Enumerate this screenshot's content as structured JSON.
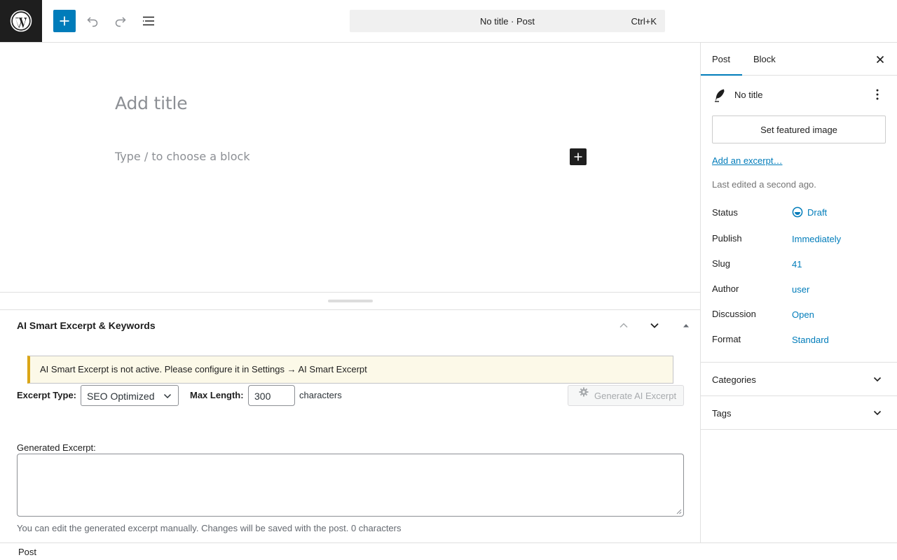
{
  "header": {
    "command_bar_title": "No title · Post",
    "command_bar_shortcut": "Ctrl+K"
  },
  "editor": {
    "title_placeholder": "Add title",
    "block_placeholder": "Type / to choose a block"
  },
  "metabox": {
    "title": "AI Smart Excerpt & Keywords",
    "notice": "AI Smart Excerpt is not active. Please configure it in Settings → AI Smart Excerpt",
    "excerpt_type_label": "Excerpt Type:",
    "excerpt_type_value": "SEO Optimized",
    "max_length_label": "Max Length:",
    "max_length_value": "300",
    "characters_label": "characters",
    "generate_button": "Generate AI Excerpt",
    "generated_label": "Generated Excerpt:",
    "help_text": "You can edit the generated excerpt manually. Changes will be saved with the post. 0 characters"
  },
  "footer": {
    "breadcrumb": "Post"
  },
  "sidebar": {
    "tabs": [
      {
        "label": "Post",
        "active": true
      },
      {
        "label": "Block",
        "active": false
      }
    ],
    "post_title": "No title",
    "featured_image_button": "Set featured image",
    "excerpt_link": "Add an excerpt…",
    "last_edited": "Last edited a second ago.",
    "rows": {
      "status": {
        "label": "Status",
        "value": "Draft"
      },
      "publish": {
        "label": "Publish",
        "value": "Immediately"
      },
      "slug": {
        "label": "Slug",
        "value": "41"
      },
      "author": {
        "label": "Author",
        "value": "user"
      },
      "discussion": {
        "label": "Discussion",
        "value": "Open"
      },
      "format": {
        "label": "Format",
        "value": "Standard"
      }
    },
    "panels": {
      "categories": "Categories",
      "tags": "Tags"
    }
  },
  "colors": {
    "accent": "#007cba",
    "dark": "#1e1e1e",
    "notice_border": "#dba617",
    "notice_bg": "#fcf9e8"
  },
  "icons": {
    "logo": "wordpress-logo-icon",
    "inserter": "plus-icon",
    "undo": "undo-icon",
    "redo": "redo-icon",
    "outline": "document-outline-icon",
    "close": "close-icon",
    "post": "feather-icon",
    "more": "more-vertical-icon",
    "status": "draft-status-icon",
    "gear": "gear-icon",
    "chevron": "chevron-down-icon"
  }
}
